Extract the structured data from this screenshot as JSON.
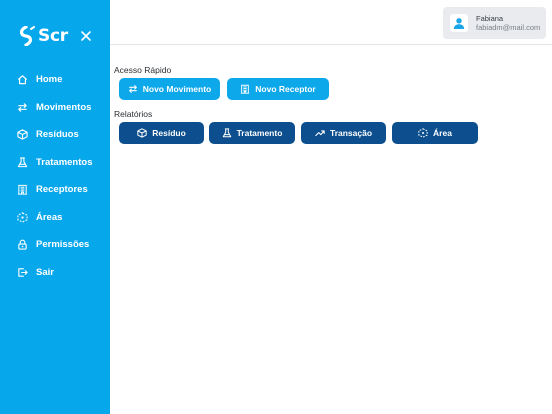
{
  "brand": {
    "name": "Scr"
  },
  "sidebar": {
    "items": [
      {
        "label": "Home",
        "icon": "home-icon"
      },
      {
        "label": "Movimentos",
        "icon": "swap-arrows-icon"
      },
      {
        "label": "Resíduos",
        "icon": "cube-icon"
      },
      {
        "label": "Tratamentos",
        "icon": "flask-icon"
      },
      {
        "label": "Receptores",
        "icon": "building-icon"
      },
      {
        "label": "Áreas",
        "icon": "area-cube-icon"
      },
      {
        "label": "Permissões",
        "icon": "lock-icon"
      },
      {
        "label": "Sair",
        "icon": "logout-icon"
      }
    ]
  },
  "user": {
    "name": "Fabiana",
    "email": "fabiadm@mail.com"
  },
  "quick_access": {
    "title": "Acesso Rápido",
    "buttons": [
      {
        "label": "Novo Movimento",
        "icon": "swap-arrows-icon"
      },
      {
        "label": "Novo Receptor",
        "icon": "building-icon"
      }
    ]
  },
  "reports": {
    "title": "Relatórios",
    "buttons": [
      {
        "label": "Resíduo",
        "icon": "cube-icon"
      },
      {
        "label": "Tratamento",
        "icon": "flask-icon"
      },
      {
        "label": "Transação",
        "icon": "trend-up-icon"
      },
      {
        "label": "Área",
        "icon": "area-cube-icon"
      }
    ]
  },
  "colors": {
    "sidebar": "#07a7ec",
    "primary_light": "#0da8ea",
    "primary_dark": "#0c4e8e",
    "avatar_accent": "#1aa6e8"
  }
}
